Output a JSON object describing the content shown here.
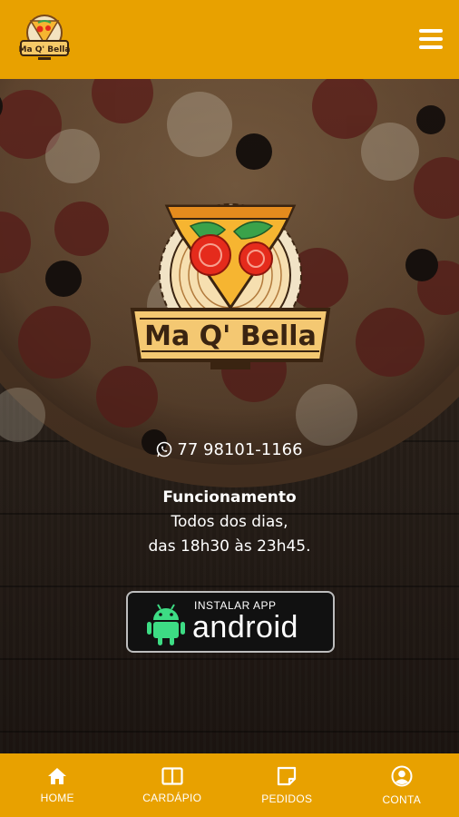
{
  "header": {
    "logo_text": "Ma Q' Bella",
    "menu_icon": "hamburger-menu-icon"
  },
  "hero": {
    "logo_text": "Ma Q' Bella",
    "phone_icon": "whatsapp-icon",
    "phone": "77 98101-1166",
    "hours_title": "Funcionamento",
    "hours_line1": "Todos dos dias,",
    "hours_line2": "das 18h30 às 23h45.",
    "app_button": {
      "small_text": "INSTALAR APP",
      "big_text": "android",
      "icon": "android-robot-icon"
    }
  },
  "nav": {
    "items": [
      {
        "label": "HOME",
        "icon": "home-icon"
      },
      {
        "label": "CARDÁPIO",
        "icon": "menu-book-icon"
      },
      {
        "label": "PEDIDOS",
        "icon": "orders-icon"
      },
      {
        "label": "CONTA",
        "icon": "account-icon"
      }
    ]
  },
  "colors": {
    "brand_yellow": "#e8a100",
    "logo_orange": "#f6b531",
    "logo_brown": "#3a2411",
    "tomato_red": "#e52b1c",
    "basil_green": "#3aa24a"
  }
}
